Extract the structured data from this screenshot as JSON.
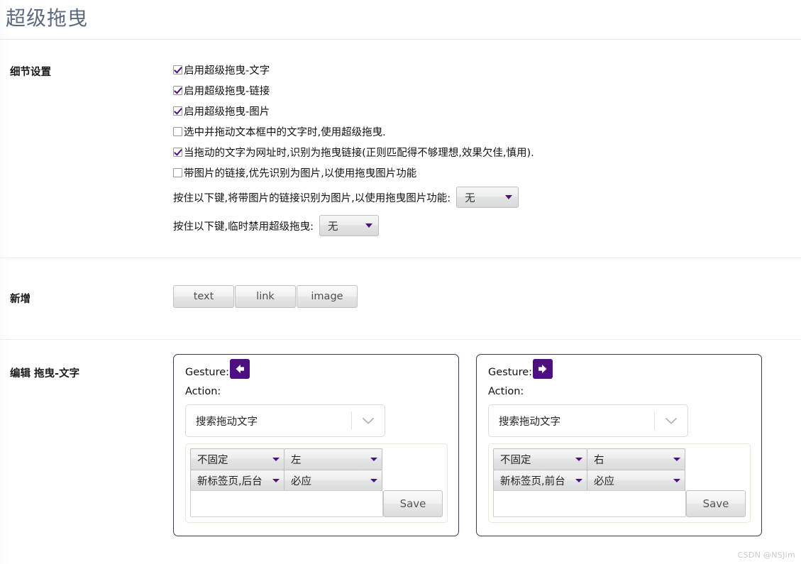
{
  "header": {
    "title": "超级拖曳"
  },
  "sections": {
    "detail": {
      "label": "细节设置",
      "options": [
        {
          "label": "启用超级拖曳-文字",
          "checked": true
        },
        {
          "label": "启用超级拖曳-链接",
          "checked": true
        },
        {
          "label": "启用超级拖曳-图片",
          "checked": true
        },
        {
          "label": "选中并拖动文本框中的文字时,使用超级拖曳.",
          "checked": false
        },
        {
          "label": "当拖动的文字为网址时,识别为拖曳链接(正则匹配得不够理想,效果欠佳,慎用).",
          "checked": true
        },
        {
          "label": "带图片的链接,优先识别为图片,以使用拖曳图片功能",
          "checked": false
        }
      ],
      "key_rows": [
        {
          "text": "按住以下键,将带图片的链接识别为图片,以使用拖曳图片功能:",
          "value": "无"
        },
        {
          "text": "按住以下键,临时禁用超级拖曳:",
          "value": "无"
        }
      ]
    },
    "add": {
      "label": "新增",
      "buttons": [
        "text",
        "link",
        "image"
      ]
    },
    "edit": {
      "label": "编辑 拖曳-文字",
      "gesture_label": "Gesture:",
      "action_label": "Action:",
      "save_label": "Save",
      "cards": [
        {
          "gesture_icon": "arrow-left-icon",
          "action_value": "搜索拖动文字",
          "select_fix": "不固定",
          "select_dir": "左",
          "select_tab": "新标签页,后台",
          "select_resp": "必应",
          "input_value": ""
        },
        {
          "gesture_icon": "arrow-right-icon",
          "action_value": "搜索拖动文字",
          "select_fix": "不固定",
          "select_dir": "右",
          "select_tab": "新标签页,前台",
          "select_resp": "必应",
          "input_value": ""
        }
      ]
    }
  },
  "watermark": "CSDN @NSJim",
  "colors": {
    "accent_purple": "#4d1080",
    "title_gray_blue": "#5d6a7e",
    "card_border": "#3b3560",
    "panel_border": "#e7e8dc"
  }
}
